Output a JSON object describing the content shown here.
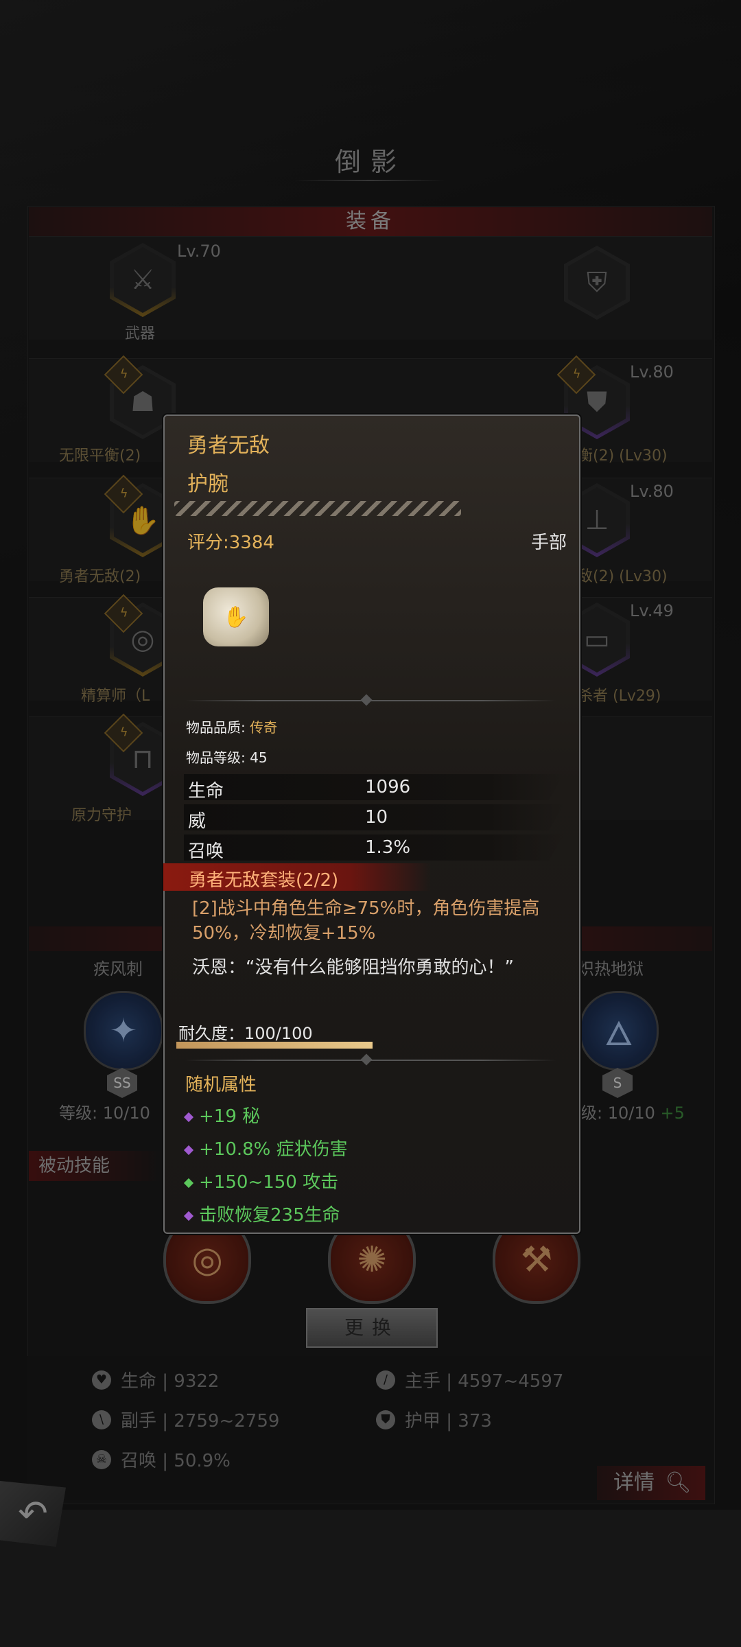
{
  "header": {
    "title": "倒影"
  },
  "equipment": {
    "section_title": "装备",
    "slots": [
      {
        "name": "武器",
        "level": "Lv.70"
      },
      {
        "name": "无限平衡(2)",
        "level": ""
      },
      {
        "name": "勇者无敌(2)",
        "level": ""
      },
      {
        "name": "精算师（L",
        "level": ""
      },
      {
        "name": "原力守护",
        "level": ""
      },
      {
        "name": "衡(2) (Lv30)",
        "level": "Lv.80"
      },
      {
        "name": "敌(2) (Lv30)",
        "level": "Lv.80"
      },
      {
        "name": "杀者 (Lv29)",
        "level": "Lv.49"
      }
    ]
  },
  "skills": {
    "left": {
      "name": "疾风刺",
      "grade": "SS",
      "level": "等级: 10/10"
    },
    "right": {
      "name": "炽热地狱",
      "grade": "S",
      "level": "级: 10/10",
      "bonus": "+5"
    },
    "passive_title": "被动技能",
    "swap_label": "更换"
  },
  "stats": {
    "hp": "生命 | 9322",
    "main_hand": "主手 | 4597~4597",
    "off_hand": "副手 | 2759~2759",
    "armor": "护甲 | 373",
    "summon": "召唤 | 50.9%",
    "detail_label": "详情"
  },
  "tooltip": {
    "name": "勇者无敌",
    "type": "护腕",
    "score": "评分:3384",
    "slot": "手部",
    "quality_label": "物品品质: ",
    "quality_value": "传奇",
    "item_level": "物品等级: 45",
    "base_stats": [
      {
        "label": "生命",
        "value": "1096"
      },
      {
        "label": "威",
        "value": "10"
      },
      {
        "label": "召唤",
        "value": "1.3%"
      }
    ],
    "set_title": "勇者无敌套装(2/2)",
    "set_effect": "[2]战斗中角色生命≥75%时，角色伤害提高 50%，冷却恢复+15%",
    "quote": "沃恩：“没有什么能够阻挡你勇敢的心！”",
    "durability_label": "耐久度：100/100",
    "durability": 1.0,
    "random_title": "随机属性",
    "random_attrs": [
      {
        "text": "+19 秘",
        "color": "#a05ad0"
      },
      {
        "text": "+10.8% 症状伤害",
        "color": "#a05ad0"
      },
      {
        "text": "+150~150 攻击",
        "color": "#5cc85c"
      },
      {
        "text": "击败恢复235生命",
        "color": "#a05ad0"
      }
    ]
  },
  "colors": {
    "gold_text": "#e3b25a",
    "green_text": "#5cc85c",
    "set_red": "#8a1a10"
  }
}
